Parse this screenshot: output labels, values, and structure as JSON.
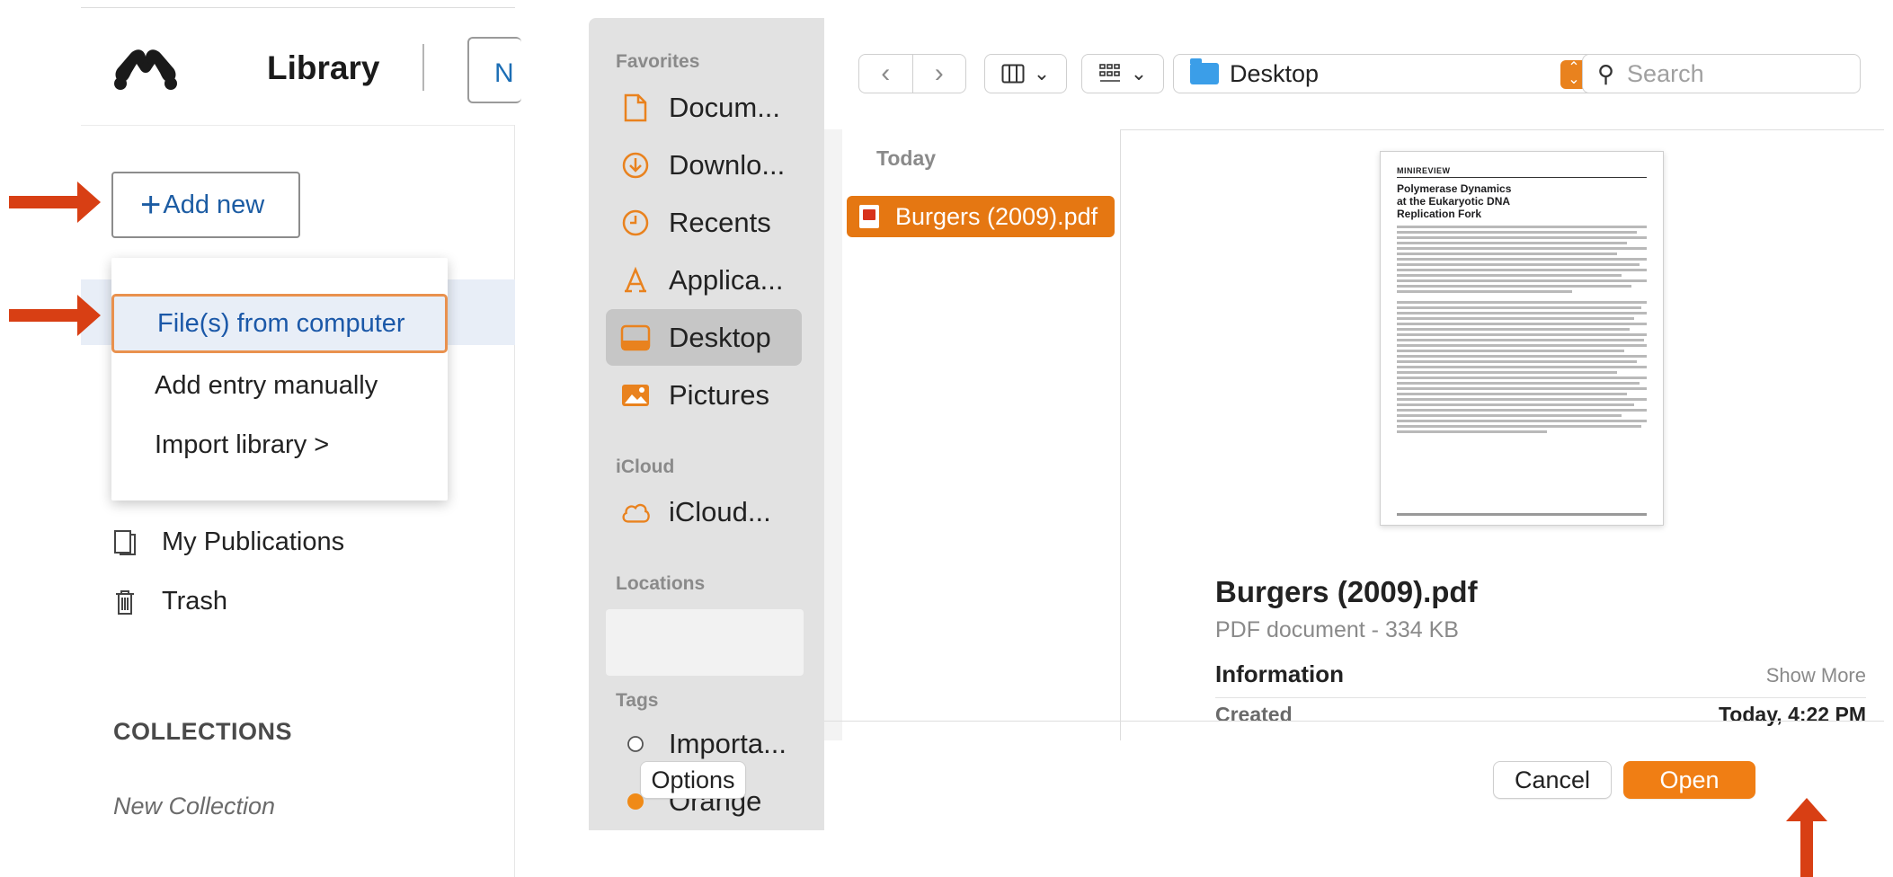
{
  "library": {
    "title": "Library",
    "new_button_partial": "N",
    "add_new_label": "Add new",
    "menu": [
      {
        "label": "File(s) from computer"
      },
      {
        "label": "Add entry manually"
      },
      {
        "label": "Import library >"
      }
    ],
    "nav": [
      {
        "label": "My Publications"
      },
      {
        "label": "Trash"
      }
    ],
    "collections_heading": "COLLECTIONS",
    "new_collection": "New Collection"
  },
  "dialog": {
    "sidebar": {
      "favorites_heading": "Favorites",
      "favorites": [
        {
          "label": "Docum...",
          "icon": "document-icon"
        },
        {
          "label": "Downlo...",
          "icon": "download-icon"
        },
        {
          "label": "Recents",
          "icon": "clock-icon"
        },
        {
          "label": "Applica...",
          "icon": "applications-icon"
        },
        {
          "label": "Desktop",
          "icon": "desktop-icon"
        },
        {
          "label": "Pictures",
          "icon": "pictures-icon"
        }
      ],
      "icloud_heading": "iCloud",
      "icloud": [
        {
          "label": "iCloud...",
          "icon": "cloud-icon"
        }
      ],
      "locations_heading": "Locations",
      "tags_heading": "Tags",
      "tags": [
        {
          "label": "Importa...",
          "color": "#ffffff"
        },
        {
          "label": "Orange",
          "color": "#f08a17"
        }
      ]
    },
    "toolbar": {
      "location": "Desktop",
      "search_placeholder": "Search"
    },
    "browser": {
      "group_label": "Today",
      "files": [
        {
          "name": "Burgers (2009).pdf"
        }
      ]
    },
    "preview": {
      "doc_header": "MINIREVIEW",
      "doc_title": "Polymerase Dynamics at the Eukaryotic DNA Replication Fork",
      "file_name": "Burgers (2009).pdf",
      "file_kind": "PDF document - 334 KB",
      "info_heading": "Information",
      "show_more": "Show More",
      "created_label": "Created",
      "created_value": "Today, 4:22 PM"
    },
    "buttons": {
      "options": "Options",
      "cancel": "Cancel",
      "open": "Open"
    }
  },
  "colors": {
    "accent_orange": "#f07e14",
    "annotation_arrow": "#d83f14",
    "menu_selected_border": "#e9914e",
    "link_blue": "#1c5ca3"
  }
}
